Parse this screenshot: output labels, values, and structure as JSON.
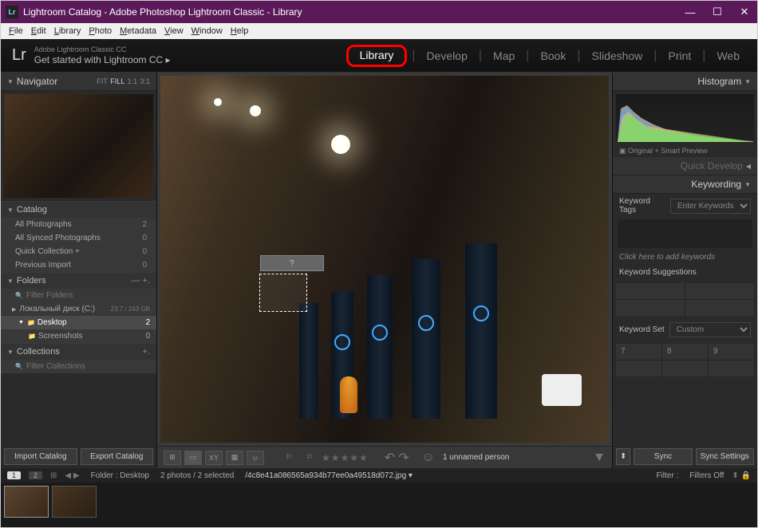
{
  "window": {
    "title": "Lightroom Catalog - Adobe Photoshop Lightroom Classic - Library",
    "logo": "Lr"
  },
  "menu": {
    "file": "File",
    "edit": "Edit",
    "library": "Library",
    "photo": "Photo",
    "metadata": "Metadata",
    "view": "View",
    "window": "Window",
    "help": "Help"
  },
  "brand": {
    "subtitle": "Adobe Lightroom Classic CC",
    "getstarted": "Get started with Lightroom CC  ▸"
  },
  "modules": {
    "library": "Library",
    "develop": "Develop",
    "map": "Map",
    "book": "Book",
    "slideshow": "Slideshow",
    "print": "Print",
    "web": "Web"
  },
  "navigator": {
    "title": "Navigator",
    "fit": "FIT",
    "fill": "FILL",
    "one": "1:1",
    "three": "3:1"
  },
  "catalog": {
    "title": "Catalog",
    "rows": [
      {
        "label": "All Photographs",
        "count": "2"
      },
      {
        "label": "All Synced Photographs",
        "count": "0"
      },
      {
        "label": "Quick Collection  +",
        "count": "0"
      },
      {
        "label": "Previous Import",
        "count": "0"
      }
    ]
  },
  "folders": {
    "title": "Folders",
    "filter": "Filter Folders",
    "disk": "Локальный диск (C:)",
    "disk_usage": "23.7 / 243 GB",
    "items": [
      {
        "label": "Desktop",
        "count": "2",
        "selected": true
      },
      {
        "label": "Screenshots",
        "count": "0",
        "selected": false
      }
    ]
  },
  "collections": {
    "title": "Collections",
    "filter": "Filter Collections"
  },
  "import": {
    "import_btn": "Import Catalog",
    "export_btn": "Export Catalog"
  },
  "histogram": {
    "title": "Histogram",
    "label": "Original + Smart Preview",
    "quickdev": "Quick Develop"
  },
  "keywording": {
    "title": "Keywording",
    "tags_label": "Keyword Tags",
    "enter": "Enter Keywords",
    "placeholder": "Click here to add keywords",
    "suggestions": "Keyword Suggestions",
    "set_label": "Keyword Set",
    "custom": "Custom",
    "nums": [
      "7",
      "8",
      "9"
    ]
  },
  "sync": {
    "sync_btn": "Sync",
    "sync_settings": "Sync Settings"
  },
  "toolbar": {
    "face_tooltip": "?",
    "unnamed": "1 unnamed person",
    "xygrid": "XY"
  },
  "filmstrip": {
    "page1": "1",
    "page2": "2",
    "folder_label": "Folder : Desktop",
    "selection": "2 photos / 2 selected",
    "filename": "4c8e41a086565a934b77ee0a49518d072.jpg",
    "filter_label": "Filter :",
    "filters_off": "Filters Off"
  }
}
